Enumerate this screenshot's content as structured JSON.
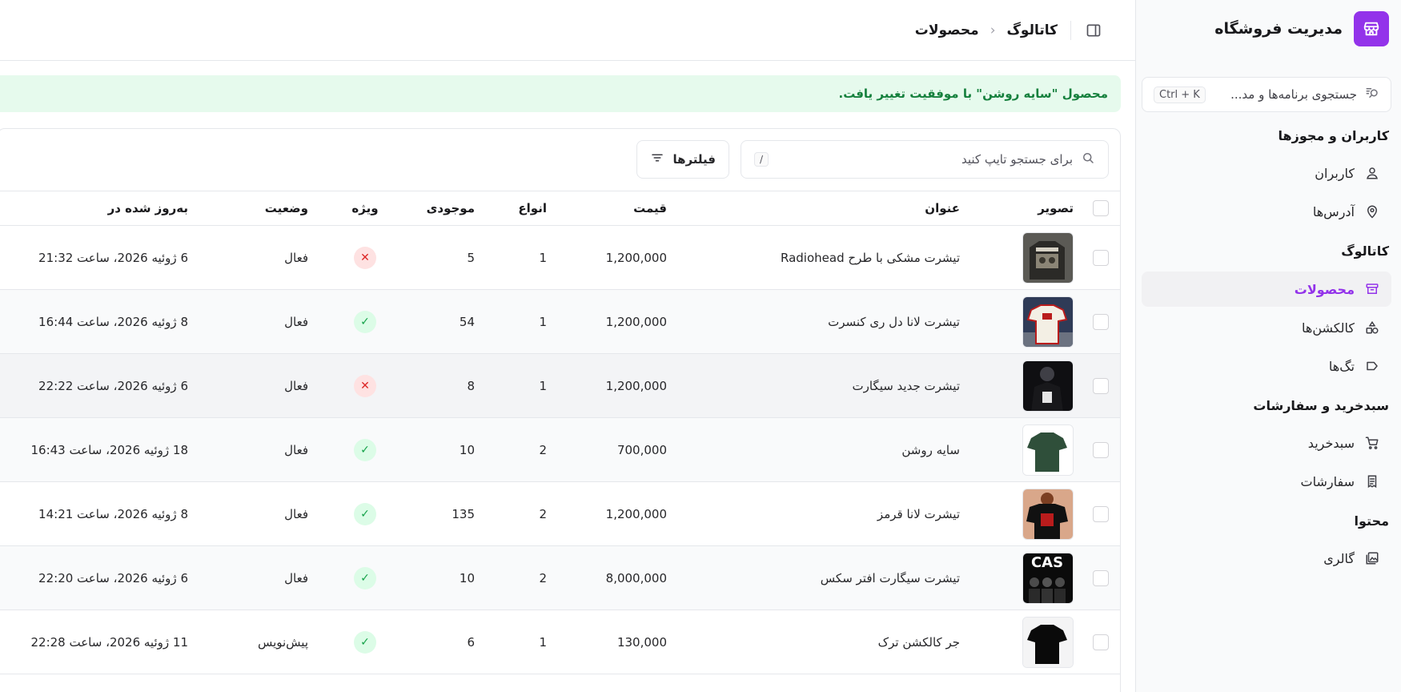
{
  "colors": {
    "accent": "#9333ea",
    "success_bg": "#e6faed",
    "success_text": "#15803d",
    "featured_yes": "#16a34a",
    "featured_no": "#dc2626"
  },
  "sidebar": {
    "brand": "مدیریت فروشگاه",
    "search": {
      "placeholder": "جستجوی برنامه‌ها و مد...",
      "shortcut": "Ctrl + K"
    },
    "groups": [
      {
        "title": "کاربران و مجوزها",
        "items": [
          {
            "label": "کاربران",
            "icon": "user-icon"
          },
          {
            "label": "آدرس‌ها",
            "icon": "map-pin-icon"
          }
        ]
      },
      {
        "title": "کاتالوگ",
        "items": [
          {
            "label": "محصولات",
            "icon": "archive-icon",
            "active": true
          },
          {
            "label": "کالکشن‌ها",
            "icon": "shapes-icon"
          },
          {
            "label": "تگ‌ها",
            "icon": "tag-icon"
          }
        ]
      },
      {
        "title": "سبدخرید و سفارشات",
        "items": [
          {
            "label": "سبدخرید",
            "icon": "cart-icon"
          },
          {
            "label": "سفارشات",
            "icon": "receipt-icon"
          }
        ]
      },
      {
        "title": "محتوا",
        "items": [
          {
            "label": "گالری",
            "icon": "gallery-icon"
          }
        ]
      }
    ]
  },
  "header": {
    "breadcrumb": [
      "کاتالوگ",
      "محصولات"
    ],
    "separator": "‹"
  },
  "alert": {
    "message": "محصول \"سایه روشن\" با موفقیت تغییر یافت."
  },
  "table": {
    "search_placeholder": "برای جستجو تایپ کنید",
    "search_shortcut": "/",
    "filters_label": "فیلترها",
    "columns": {
      "image": "تصویر",
      "title": "عنوان",
      "price": "قیمت",
      "variants": "انواع",
      "stock": "موجودی",
      "featured": "ویژه",
      "status": "وضعیت",
      "updated": "به‌روز شده در"
    },
    "rows": [
      {
        "title": "تیشرت مشکی با طرح Radiohead",
        "price": "1,200,000",
        "variants": "1",
        "stock": "5",
        "featured": false,
        "status": "فعال",
        "updated": "6 ژوئیه 2026، ساعت 21:32",
        "thumb": "poster-dark"
      },
      {
        "title": "تیشرت لانا دل ری کنسرت",
        "price": "1,200,000",
        "variants": "1",
        "stock": "54",
        "featured": true,
        "status": "فعال",
        "updated": "8 ژوئیه 2026، ساعت 16:44",
        "thumb": "ringer-white"
      },
      {
        "title": "تیشرت جدید سیگارت",
        "price": "1,200,000",
        "variants": "1",
        "stock": "8",
        "featured": false,
        "status": "فعال",
        "updated": "6 ژوئیه 2026، ساعت 22:22",
        "thumb": "person-black"
      },
      {
        "title": "سایه روشن",
        "price": "700,000",
        "variants": "2",
        "stock": "10",
        "featured": true,
        "status": "فعال",
        "updated": "18 ژوئیه 2026، ساعت 16:43",
        "thumb": "tee-green"
      },
      {
        "title": "تیشرت لانا قرمز",
        "price": "1,200,000",
        "variants": "2",
        "stock": "135",
        "featured": true,
        "status": "فعال",
        "updated": "8 ژوئیه 2026، ساعت 14:21",
        "thumb": "person-red"
      },
      {
        "title": "تیشرت سیگارت افتر سکس",
        "price": "8,000,000",
        "variants": "2",
        "stock": "10",
        "featured": true,
        "status": "فعال",
        "updated": "6 ژوئیه 2026، ساعت 22:20",
        "thumb": "band-cas"
      },
      {
        "title": "جر کالکشن ترک",
        "price": "130,000",
        "variants": "1",
        "stock": "6",
        "featured": true,
        "status": "پیش‌نویس",
        "updated": "11 ژوئیه 2026، ساعت 22:28",
        "thumb": "tee-black"
      }
    ]
  }
}
